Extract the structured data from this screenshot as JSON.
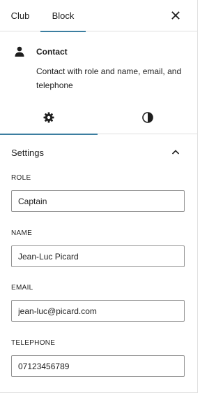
{
  "tabs": {
    "club_label": "Club",
    "block_label": "Block",
    "close_icon": "close-icon"
  },
  "block": {
    "icon": "person-icon",
    "title": "Contact",
    "description": "Contact with role and name, email, and telephone"
  },
  "sub_tabs": {
    "settings_icon": "gear-icon",
    "styles_icon": "half-circle-contrast-icon",
    "active": "settings"
  },
  "settings": {
    "title": "Settings",
    "expanded": true,
    "fields": {
      "role": {
        "label": "ROLE",
        "value": "Captain"
      },
      "name": {
        "label": "NAME",
        "value": "Jean-Luc Picard"
      },
      "email": {
        "label": "EMAIL",
        "value": "jean-luc@picard.com"
      },
      "telephone": {
        "label": "TELEPHONE",
        "value": "07123456789"
      }
    }
  },
  "colors": {
    "accent": "#3c7ea0",
    "border": "#e0e0e0",
    "input_border": "#949494",
    "text": "#1e1e1e"
  }
}
